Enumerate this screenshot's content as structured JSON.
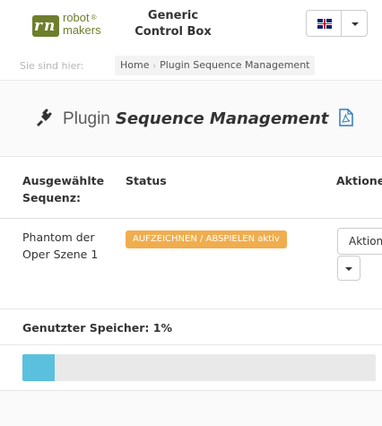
{
  "header": {
    "logo": {
      "line1": "robot",
      "line2": "makers",
      "mark": "®",
      "brand_color": "#6d7f2c"
    },
    "app_title_line1": "Generic",
    "app_title_line2": "Control Box",
    "language": {
      "flag": "uk-flag-icon",
      "dropdown_icon": "caret-down-icon"
    }
  },
  "breadcrumb": {
    "prefix": "Sie sind hier:",
    "items": [
      "Home",
      "Plugin Sequence Management"
    ],
    "separator": "›"
  },
  "page": {
    "title_prefix": "Plugin",
    "title_main": "Sequence Management",
    "icons": [
      "plug-icon",
      "pdf-icon"
    ]
  },
  "table": {
    "headers": [
      "Ausgewählte Sequenz:",
      "Status",
      "Aktionen"
    ],
    "rows": [
      {
        "sequence": "Phantom der Oper Szene 1",
        "status": "AUFZEICHNEN / ABSPIELEN aktiv",
        "action_label": "Aktionen"
      }
    ]
  },
  "memory": {
    "label": "Genutzter Speicher: 1%",
    "used_percent": 1
  },
  "colors": {
    "badge_warning": "#f0ad4e",
    "progress_fill": "#5bc0de",
    "progress_track": "#e9e9e9"
  }
}
